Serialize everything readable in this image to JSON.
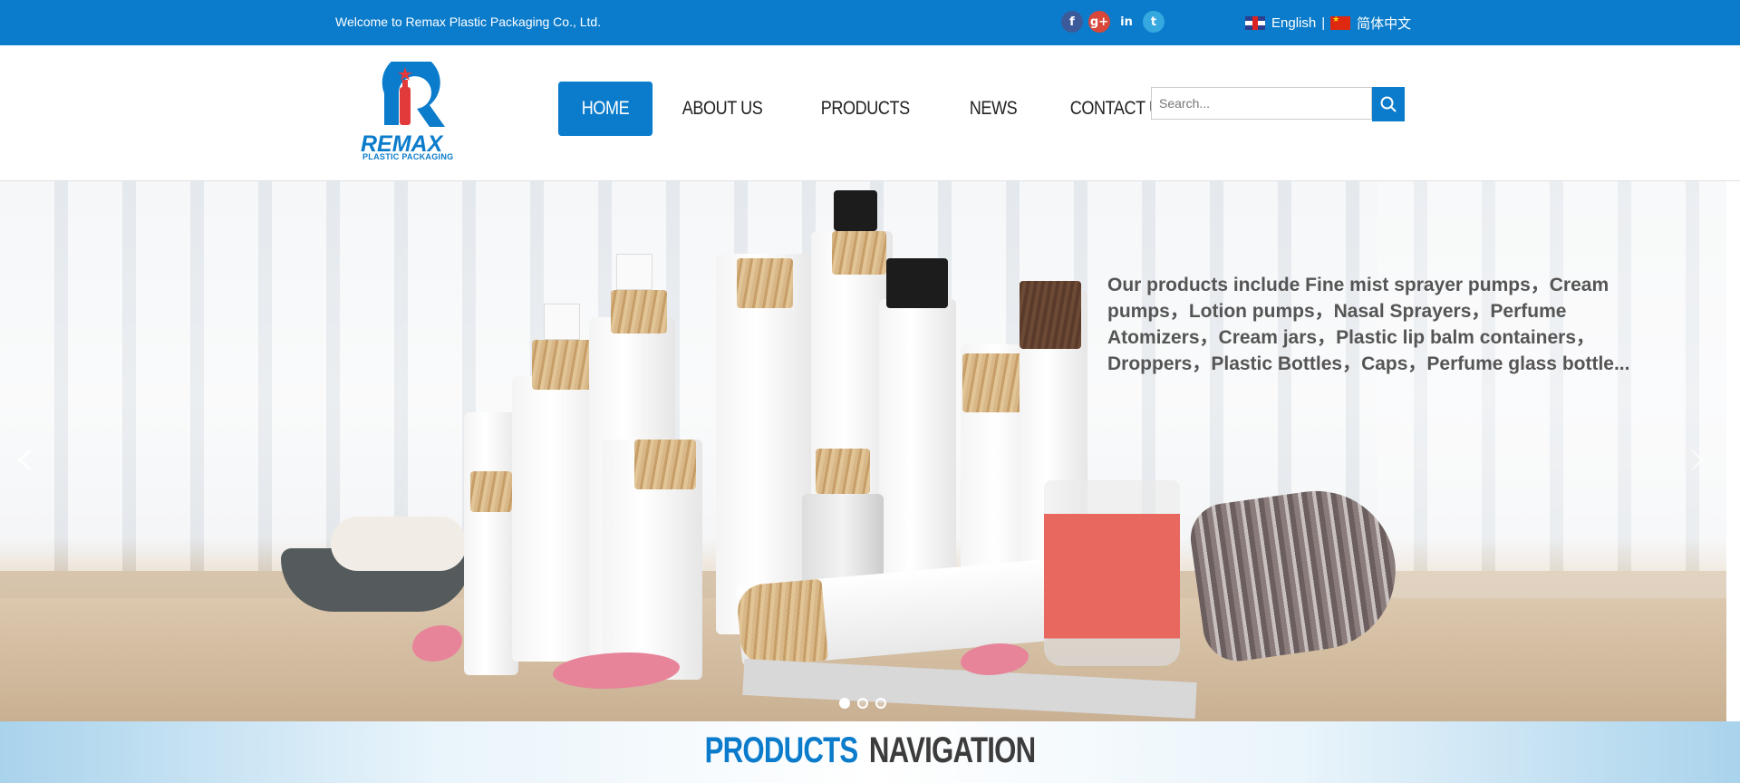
{
  "topbar": {
    "welcome": "Welcome to Remax Plastic Packaging Co., Ltd.",
    "social": [
      {
        "name": "facebook-icon",
        "glyph": "f"
      },
      {
        "name": "google-plus-icon",
        "glyph": "g+"
      },
      {
        "name": "linkedin-icon",
        "glyph": "in"
      },
      {
        "name": "twitter-icon",
        "glyph": "t"
      }
    ],
    "lang_english": "English",
    "lang_separator": "|",
    "lang_chinese": "简体中文"
  },
  "logo": {
    "text": "REMAX",
    "sub": "PLASTIC PACKAGING"
  },
  "nav": {
    "items": [
      "HOME",
      "ABOUT US",
      "PRODUCTS",
      "NEWS",
      "CONTACT US"
    ],
    "active_index": 0
  },
  "search": {
    "placeholder": "Search..."
  },
  "banner": {
    "text": "Our products include Fine mist sprayer pumps，Cream pumps，Lotion pumps，Nasal Sprayers，Perfume Atomizers，Cream jars，Plastic lip balm containers，Droppers，Plastic Bottles，Caps，Perfume glass bottle...",
    "prev_arrow": "‹",
    "next_arrow": "›",
    "slide_count": 3,
    "active_slide": 0
  },
  "products_nav": {
    "title_part1": "PRODUCTS",
    "title_part2": "NAVIGATION"
  },
  "colors": {
    "brand_blue": "#0b7ccb",
    "text_dark": "#3c3c3c"
  }
}
